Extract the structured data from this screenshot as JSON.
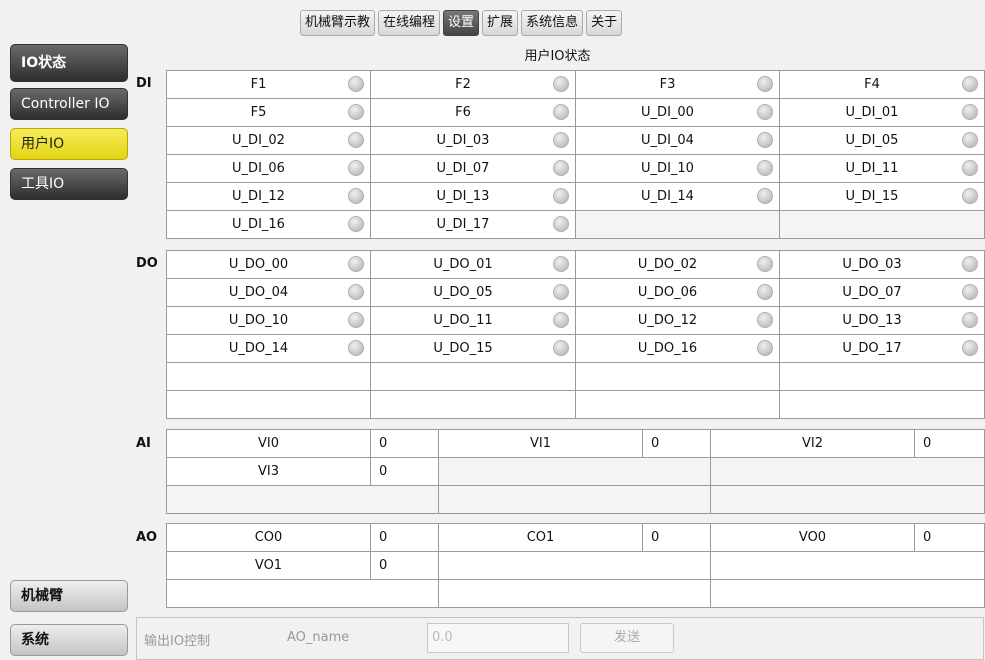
{
  "tabs": [
    {
      "label": "机械臂示教"
    },
    {
      "label": "在线编程"
    },
    {
      "label": "设置"
    },
    {
      "label": "扩展"
    },
    {
      "label": "系统信息"
    },
    {
      "label": "关于"
    }
  ],
  "page_title": "用户IO状态",
  "sidebar": {
    "header": "IO状态",
    "items": [
      {
        "label": "Controller IO"
      },
      {
        "label": "用户IO"
      },
      {
        "label": "工具IO"
      }
    ],
    "bottom": [
      {
        "label": "机械臂"
      },
      {
        "label": "系统"
      }
    ]
  },
  "di": {
    "label": "DI",
    "rows": [
      [
        "F1",
        "F2",
        "F3",
        "F4"
      ],
      [
        "F5",
        "F6",
        "U_DI_00",
        "U_DI_01"
      ],
      [
        "U_DI_02",
        "U_DI_03",
        "U_DI_04",
        "U_DI_05"
      ],
      [
        "U_DI_06",
        "U_DI_07",
        "U_DI_10",
        "U_DI_11"
      ],
      [
        "U_DI_12",
        "U_DI_13",
        "U_DI_14",
        "U_DI_15"
      ],
      [
        "U_DI_16",
        "U_DI_17",
        "",
        ""
      ]
    ]
  },
  "do": {
    "label": "DO",
    "rows": [
      [
        "U_DO_00",
        "U_DO_01",
        "U_DO_02",
        "U_DO_03"
      ],
      [
        "U_DO_04",
        "U_DO_05",
        "U_DO_06",
        "U_DO_07"
      ],
      [
        "U_DO_10",
        "U_DO_11",
        "U_DO_12",
        "U_DO_13"
      ],
      [
        "U_DO_14",
        "U_DO_15",
        "U_DO_16",
        "U_DO_17"
      ],
      [
        "",
        "",
        "",
        ""
      ],
      [
        "",
        "",
        "",
        ""
      ]
    ]
  },
  "ai": {
    "label": "AI",
    "rows": [
      [
        {
          "name": "VI0",
          "value": "0"
        },
        {
          "name": "VI1",
          "value": "0"
        },
        {
          "name": "VI2",
          "value": "0"
        }
      ],
      [
        {
          "name": "VI3",
          "value": "0"
        },
        null,
        null
      ],
      [
        null,
        null,
        null
      ]
    ]
  },
  "ao": {
    "label": "AO",
    "rows": [
      [
        {
          "name": "CO0",
          "value": "0"
        },
        {
          "name": "CO1",
          "value": "0"
        },
        {
          "name": "VO0",
          "value": "0"
        }
      ],
      [
        {
          "name": "VO1",
          "value": "0"
        },
        null,
        null
      ],
      [
        null,
        null,
        null
      ]
    ]
  },
  "control": {
    "label": "输出IO控制",
    "name_label": "AO_name",
    "input_value": "0.0",
    "send_label": "发送"
  }
}
